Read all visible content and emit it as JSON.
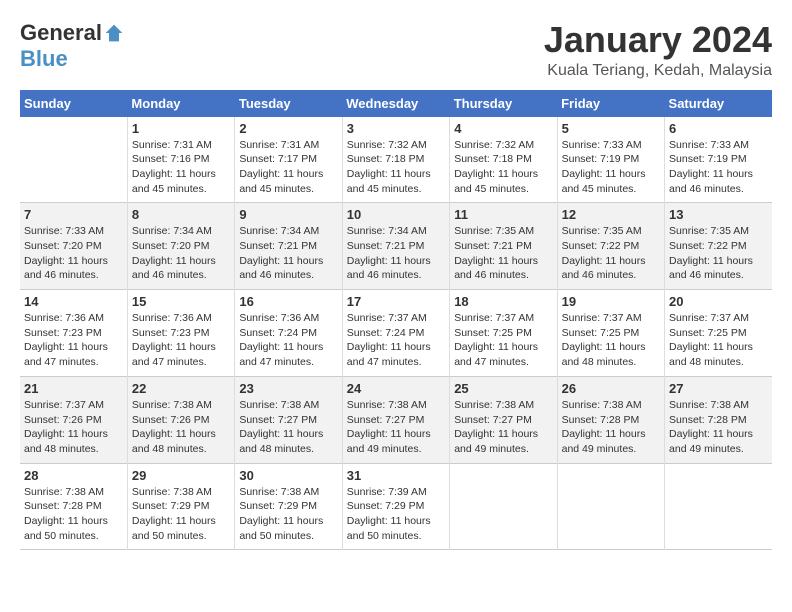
{
  "header": {
    "logo_general": "General",
    "logo_blue": "Blue",
    "month_year": "January 2024",
    "location": "Kuala Teriang, Kedah, Malaysia"
  },
  "days_of_week": [
    "Sunday",
    "Monday",
    "Tuesday",
    "Wednesday",
    "Thursday",
    "Friday",
    "Saturday"
  ],
  "weeks": [
    [
      {
        "day": "",
        "info": ""
      },
      {
        "day": "1",
        "info": "Sunrise: 7:31 AM\nSunset: 7:16 PM\nDaylight: 11 hours\nand 45 minutes."
      },
      {
        "day": "2",
        "info": "Sunrise: 7:31 AM\nSunset: 7:17 PM\nDaylight: 11 hours\nand 45 minutes."
      },
      {
        "day": "3",
        "info": "Sunrise: 7:32 AM\nSunset: 7:18 PM\nDaylight: 11 hours\nand 45 minutes."
      },
      {
        "day": "4",
        "info": "Sunrise: 7:32 AM\nSunset: 7:18 PM\nDaylight: 11 hours\nand 45 minutes."
      },
      {
        "day": "5",
        "info": "Sunrise: 7:33 AM\nSunset: 7:19 PM\nDaylight: 11 hours\nand 45 minutes."
      },
      {
        "day": "6",
        "info": "Sunrise: 7:33 AM\nSunset: 7:19 PM\nDaylight: 11 hours\nand 46 minutes."
      }
    ],
    [
      {
        "day": "7",
        "info": "Sunrise: 7:33 AM\nSunset: 7:20 PM\nDaylight: 11 hours\nand 46 minutes."
      },
      {
        "day": "8",
        "info": "Sunrise: 7:34 AM\nSunset: 7:20 PM\nDaylight: 11 hours\nand 46 minutes."
      },
      {
        "day": "9",
        "info": "Sunrise: 7:34 AM\nSunset: 7:21 PM\nDaylight: 11 hours\nand 46 minutes."
      },
      {
        "day": "10",
        "info": "Sunrise: 7:34 AM\nSunset: 7:21 PM\nDaylight: 11 hours\nand 46 minutes."
      },
      {
        "day": "11",
        "info": "Sunrise: 7:35 AM\nSunset: 7:21 PM\nDaylight: 11 hours\nand 46 minutes."
      },
      {
        "day": "12",
        "info": "Sunrise: 7:35 AM\nSunset: 7:22 PM\nDaylight: 11 hours\nand 46 minutes."
      },
      {
        "day": "13",
        "info": "Sunrise: 7:35 AM\nSunset: 7:22 PM\nDaylight: 11 hours\nand 46 minutes."
      }
    ],
    [
      {
        "day": "14",
        "info": "Sunrise: 7:36 AM\nSunset: 7:23 PM\nDaylight: 11 hours\nand 47 minutes."
      },
      {
        "day": "15",
        "info": "Sunrise: 7:36 AM\nSunset: 7:23 PM\nDaylight: 11 hours\nand 47 minutes."
      },
      {
        "day": "16",
        "info": "Sunrise: 7:36 AM\nSunset: 7:24 PM\nDaylight: 11 hours\nand 47 minutes."
      },
      {
        "day": "17",
        "info": "Sunrise: 7:37 AM\nSunset: 7:24 PM\nDaylight: 11 hours\nand 47 minutes."
      },
      {
        "day": "18",
        "info": "Sunrise: 7:37 AM\nSunset: 7:25 PM\nDaylight: 11 hours\nand 47 minutes."
      },
      {
        "day": "19",
        "info": "Sunrise: 7:37 AM\nSunset: 7:25 PM\nDaylight: 11 hours\nand 48 minutes."
      },
      {
        "day": "20",
        "info": "Sunrise: 7:37 AM\nSunset: 7:25 PM\nDaylight: 11 hours\nand 48 minutes."
      }
    ],
    [
      {
        "day": "21",
        "info": "Sunrise: 7:37 AM\nSunset: 7:26 PM\nDaylight: 11 hours\nand 48 minutes."
      },
      {
        "day": "22",
        "info": "Sunrise: 7:38 AM\nSunset: 7:26 PM\nDaylight: 11 hours\nand 48 minutes."
      },
      {
        "day": "23",
        "info": "Sunrise: 7:38 AM\nSunset: 7:27 PM\nDaylight: 11 hours\nand 48 minutes."
      },
      {
        "day": "24",
        "info": "Sunrise: 7:38 AM\nSunset: 7:27 PM\nDaylight: 11 hours\nand 49 minutes."
      },
      {
        "day": "25",
        "info": "Sunrise: 7:38 AM\nSunset: 7:27 PM\nDaylight: 11 hours\nand 49 minutes."
      },
      {
        "day": "26",
        "info": "Sunrise: 7:38 AM\nSunset: 7:28 PM\nDaylight: 11 hours\nand 49 minutes."
      },
      {
        "day": "27",
        "info": "Sunrise: 7:38 AM\nSunset: 7:28 PM\nDaylight: 11 hours\nand 49 minutes."
      }
    ],
    [
      {
        "day": "28",
        "info": "Sunrise: 7:38 AM\nSunset: 7:28 PM\nDaylight: 11 hours\nand 50 minutes."
      },
      {
        "day": "29",
        "info": "Sunrise: 7:38 AM\nSunset: 7:29 PM\nDaylight: 11 hours\nand 50 minutes."
      },
      {
        "day": "30",
        "info": "Sunrise: 7:38 AM\nSunset: 7:29 PM\nDaylight: 11 hours\nand 50 minutes."
      },
      {
        "day": "31",
        "info": "Sunrise: 7:39 AM\nSunset: 7:29 PM\nDaylight: 11 hours\nand 50 minutes."
      },
      {
        "day": "",
        "info": ""
      },
      {
        "day": "",
        "info": ""
      },
      {
        "day": "",
        "info": ""
      }
    ]
  ]
}
